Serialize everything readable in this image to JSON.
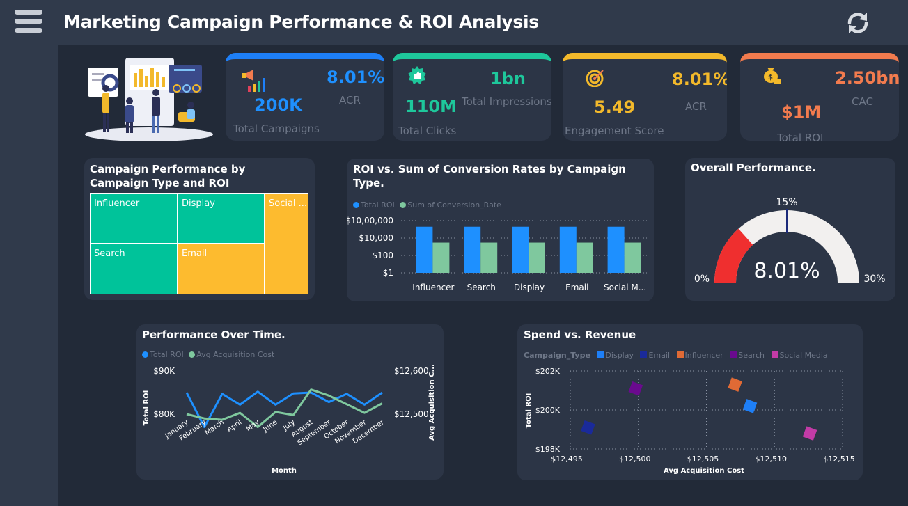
{
  "header": {
    "title": "Marketing Campaign Performance & ROI Analysis",
    "menu_icon": "hamburger-icon",
    "refresh_icon": "refresh-icon"
  },
  "kpis": [
    {
      "icon": "megaphone-chart-icon",
      "accent": "#1e7ff7",
      "main_value": "200K",
      "main_label": "Total Campaigns",
      "side_value": "8.01%",
      "side_label": "ACR",
      "main_color": "#1e90ff",
      "side_color": "#1e90ff"
    },
    {
      "icon": "thumbs-up-badge-icon",
      "accent": "#1ec79b",
      "main_value": "110M",
      "main_label": "Total Clicks",
      "side_value": "1bn",
      "side_label": "Total Impressions",
      "main_color": "#1ec79b",
      "side_color": "#1ec79b"
    },
    {
      "icon": "target-icon",
      "accent": "#f3b92b",
      "main_value": "5.49",
      "main_label": "Engagement Score",
      "side_value": "8.01%",
      "side_label": "ACR",
      "main_color": "#f3b92b",
      "side_color": "#f3b92b"
    },
    {
      "icon": "money-bag-icon",
      "accent": "#f27b4e",
      "main_value": "$1M",
      "main_label": "Total ROI",
      "side_value": "2.50bn",
      "side_label": "CAC",
      "main_color": "#f27b4e",
      "side_color": "#f27b4e"
    }
  ],
  "treemap": {
    "title_line1": "Campaign Performance by",
    "title_line2": "Campaign Type and ROI",
    "cells": [
      {
        "label": "Influencer",
        "color": "#00c39a"
      },
      {
        "label": "Display",
        "color": "#00c39a"
      },
      {
        "label": "Social ...",
        "color": "#fdbb2f"
      },
      {
        "label": "Search",
        "color": "#00c39a"
      },
      {
        "label": "Email",
        "color": "#fdbb2f"
      }
    ]
  },
  "bar_panel": {
    "title_line1": "ROI vs. Sum of Conversion Rates by Campaign",
    "title_line2": "Type."
  },
  "gauge_panel": {
    "title": "Overall Performance.",
    "min_label": "0%",
    "max_label": "30%",
    "target_label": "15%",
    "value_label": "8.01%",
    "value": 8.01,
    "min": 0,
    "max": 30,
    "target": 15
  },
  "line_panel": {
    "title": "Performance Over Time."
  },
  "scatter_panel": {
    "title": "Spend vs. Revenue",
    "legend_title": "Campaign_Type"
  },
  "chart_data": [
    {
      "type": "bar",
      "title": "ROI vs. Sum of Conversion Rates by Campaign Type.",
      "scale": "log",
      "categories": [
        "Influencer",
        "Search",
        "Display",
        "Email",
        "Social M..."
      ],
      "y_ticks": [
        "$10,00,000",
        "$10,000",
        "$100",
        "$1"
      ],
      "ylim": [
        1,
        1000000
      ],
      "series": [
        {
          "name": "Total ROI",
          "color": "#1e90ff",
          "values": [
            200000,
            200000,
            200000,
            200000,
            200000
          ]
        },
        {
          "name": "Sum of Conversion_Rate",
          "color": "#7fc89e",
          "values": [
            3000,
            3000,
            3000,
            3000,
            3000
          ]
        }
      ]
    },
    {
      "type": "line",
      "title": "Performance Over Time.",
      "xlabel": "Month",
      "ylabel": "Total ROI",
      "y2label": "Avg Acquisition C...",
      "categories": [
        "January",
        "February",
        "March",
        "April",
        "May",
        "June",
        "July",
        "August",
        "September",
        "October",
        "November",
        "December"
      ],
      "y_ticks": [
        "$90K",
        "$80K"
      ],
      "y2_ticks": [
        "$12,600",
        "$12,500"
      ],
      "ylim": [
        75000,
        95000
      ],
      "y2lim": [
        12450,
        12650
      ],
      "series": [
        {
          "name": "Total ROI",
          "color": "#1e90ff",
          "axis": "left",
          "values": [
            85000,
            77000,
            84700,
            82200,
            85200,
            82200,
            84800,
            85000,
            82800,
            84700,
            82200,
            85000
          ]
        },
        {
          "name": "Avg Acquisition Cost",
          "color": "#7fc89e",
          "axis": "right",
          "values": [
            12500,
            12490,
            12487,
            12503,
            12470,
            12505,
            12498,
            12557,
            12543,
            12523,
            12503,
            12525
          ]
        }
      ]
    },
    {
      "type": "scatter",
      "title": "Spend vs. Revenue",
      "xlabel": "Avg Acquisition Cost",
      "ylabel": "Total ROI",
      "x_ticks": [
        "$12,495",
        "$12,500",
        "$12,505",
        "$12,510",
        "$12,515"
      ],
      "y_ticks": [
        "$202K",
        "$200K",
        "$198K"
      ],
      "xlim": [
        12495,
        12515
      ],
      "ylim": [
        198000,
        202000
      ],
      "series": [
        {
          "name": "Display",
          "color": "#1e7ff7",
          "points": [
            {
              "x": 12508.2,
              "y": 200200
            }
          ]
        },
        {
          "name": "Email",
          "color": "#1a2a9a",
          "points": [
            {
              "x": 12496.3,
              "y": 199100
            }
          ]
        },
        {
          "name": "Influencer",
          "color": "#e06a35",
          "points": [
            {
              "x": 12507.1,
              "y": 201300
            }
          ]
        },
        {
          "name": "Search",
          "color": "#6a0a8e",
          "points": [
            {
              "x": 12499.8,
              "y": 201100
            }
          ]
        },
        {
          "name": "Social Media",
          "color": "#c23ba6",
          "points": [
            {
              "x": 12512.6,
              "y": 198800
            }
          ]
        }
      ]
    }
  ]
}
